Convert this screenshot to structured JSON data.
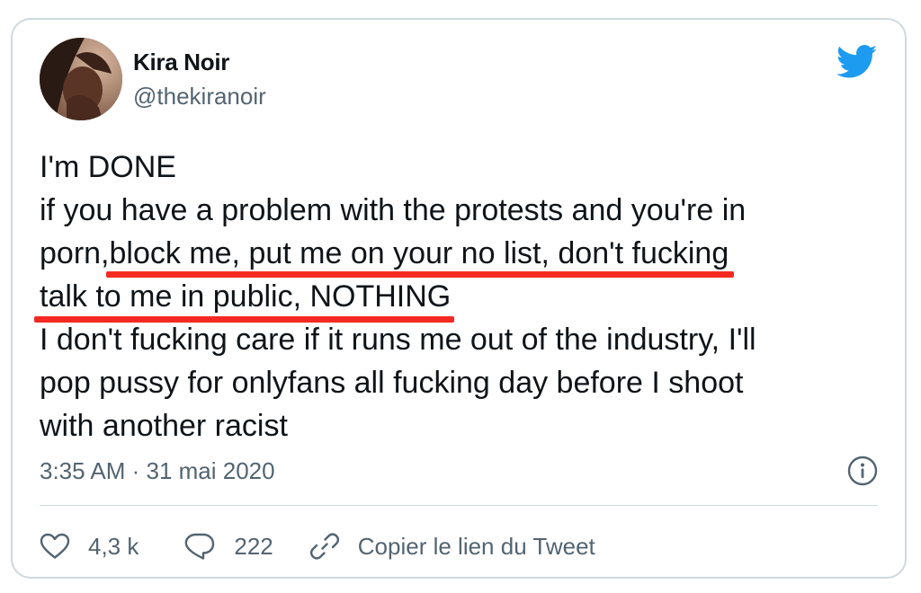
{
  "author": {
    "name": "Kira Noir",
    "handle": "@thekiranoir"
  },
  "tweet": {
    "line1": "I'm DONE",
    "line2": "if you have a problem with the protests and you're in",
    "line3_pre": "porn,",
    "line3_underlined": "block me, put me on your no list, don't fucking",
    "line4_underlined": "talk to me in public, NOTHING",
    "line5": "I don't fucking care if it runs me out of the industry, I'll",
    "line6": "pop pussy for onlyfans all fucking day before I shoot",
    "line7": "with another racist",
    "underline_color": "#f42a22"
  },
  "meta": {
    "timestamp": "3:35 AM · 31 mai 2020"
  },
  "actions": {
    "likes": "4,3 k",
    "replies": "222",
    "copy_link": "Copier le lien du Tweet"
  },
  "icons": {
    "brand": "twitter-bird-icon",
    "info": "info-icon",
    "like": "heart-icon",
    "reply": "speech-bubble-icon",
    "link": "link-icon"
  },
  "colors": {
    "twitter_blue": "#1d9bf0",
    "text": "#0f1419",
    "secondary": "#536471",
    "border": "#cfd9de"
  }
}
